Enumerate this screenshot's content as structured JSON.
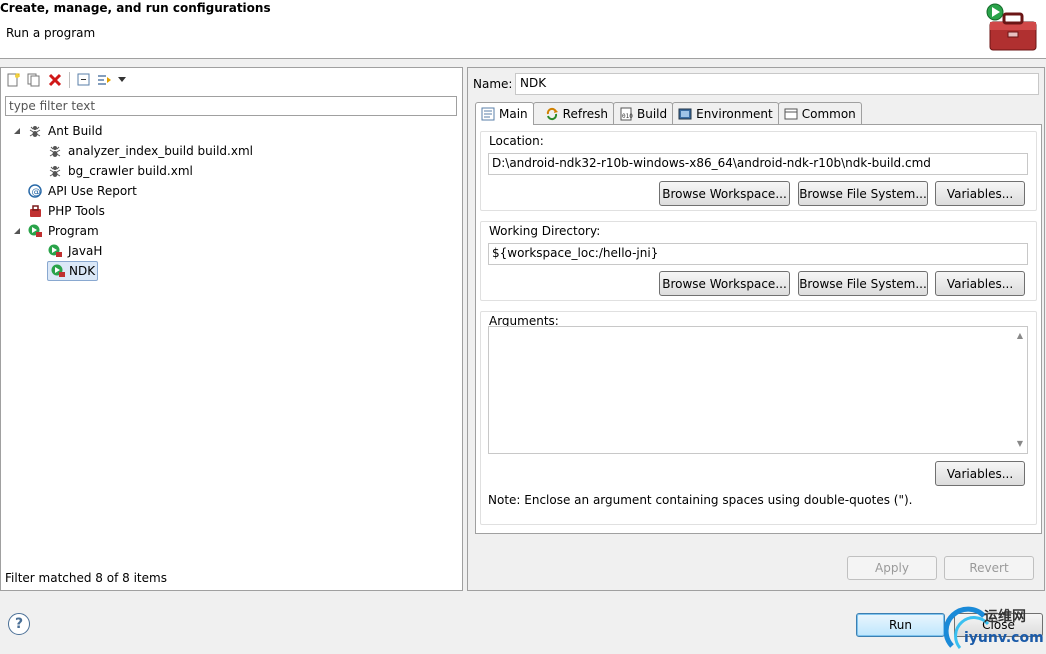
{
  "header": {
    "title": "Create, manage, and run configurations",
    "subtitle": "Run a program"
  },
  "left": {
    "filter_placeholder": "type filter text",
    "tree": [
      {
        "label": "Ant Build",
        "level": 0,
        "expanded": true,
        "icon": "ant-icon"
      },
      {
        "label": "analyzer_index_build build.xml",
        "level": 1,
        "icon": "ant-icon"
      },
      {
        "label": "bg_crawler build.xml",
        "level": 1,
        "icon": "ant-icon"
      },
      {
        "label": "API Use Report",
        "level": 0,
        "icon": "api-report-icon"
      },
      {
        "label": "PHP Tools",
        "level": 0,
        "icon": "php-tools-icon"
      },
      {
        "label": "Program",
        "level": 0,
        "expanded": true,
        "icon": "program-icon"
      },
      {
        "label": "JavaH",
        "level": 1,
        "icon": "program-icon"
      },
      {
        "label": "NDK",
        "level": 1,
        "icon": "program-icon",
        "selected": true
      }
    ],
    "status": "Filter matched 8 of 8 items"
  },
  "right": {
    "name_label": "Name:",
    "name_value": "NDK",
    "tabs": [
      {
        "label": "Main",
        "icon": "main-tab-icon",
        "active": true
      },
      {
        "label": "Refresh",
        "icon": "refresh-icon"
      },
      {
        "label": "Build",
        "icon": "build-icon"
      },
      {
        "label": "Environment",
        "icon": "environment-icon"
      },
      {
        "label": "Common",
        "icon": "common-icon"
      }
    ],
    "location": {
      "title": "Location:",
      "value": "D:\\android-ndk32-r10b-windows-x86_64\\android-ndk-r10b\\ndk-build.cmd"
    },
    "working_dir": {
      "title": "Working Directory:",
      "value": "${workspace_loc:/hello-jni}"
    },
    "arguments": {
      "title": "Arguments:",
      "value": "",
      "note": "Note: Enclose an argument containing spaces using double-quotes (\")."
    },
    "buttons": {
      "browse_workspace": "Browse Workspace...",
      "browse_file_system": "Browse File System...",
      "variables": "Variables...",
      "apply": "Apply",
      "revert": "Revert"
    }
  },
  "footer": {
    "run": "Run",
    "close": "Close"
  },
  "watermark": {
    "top": "运维网",
    "bottom": "iyunv.com"
  },
  "colors": {
    "accent": "#3c7fb1",
    "selection": "#dbe8f7"
  }
}
